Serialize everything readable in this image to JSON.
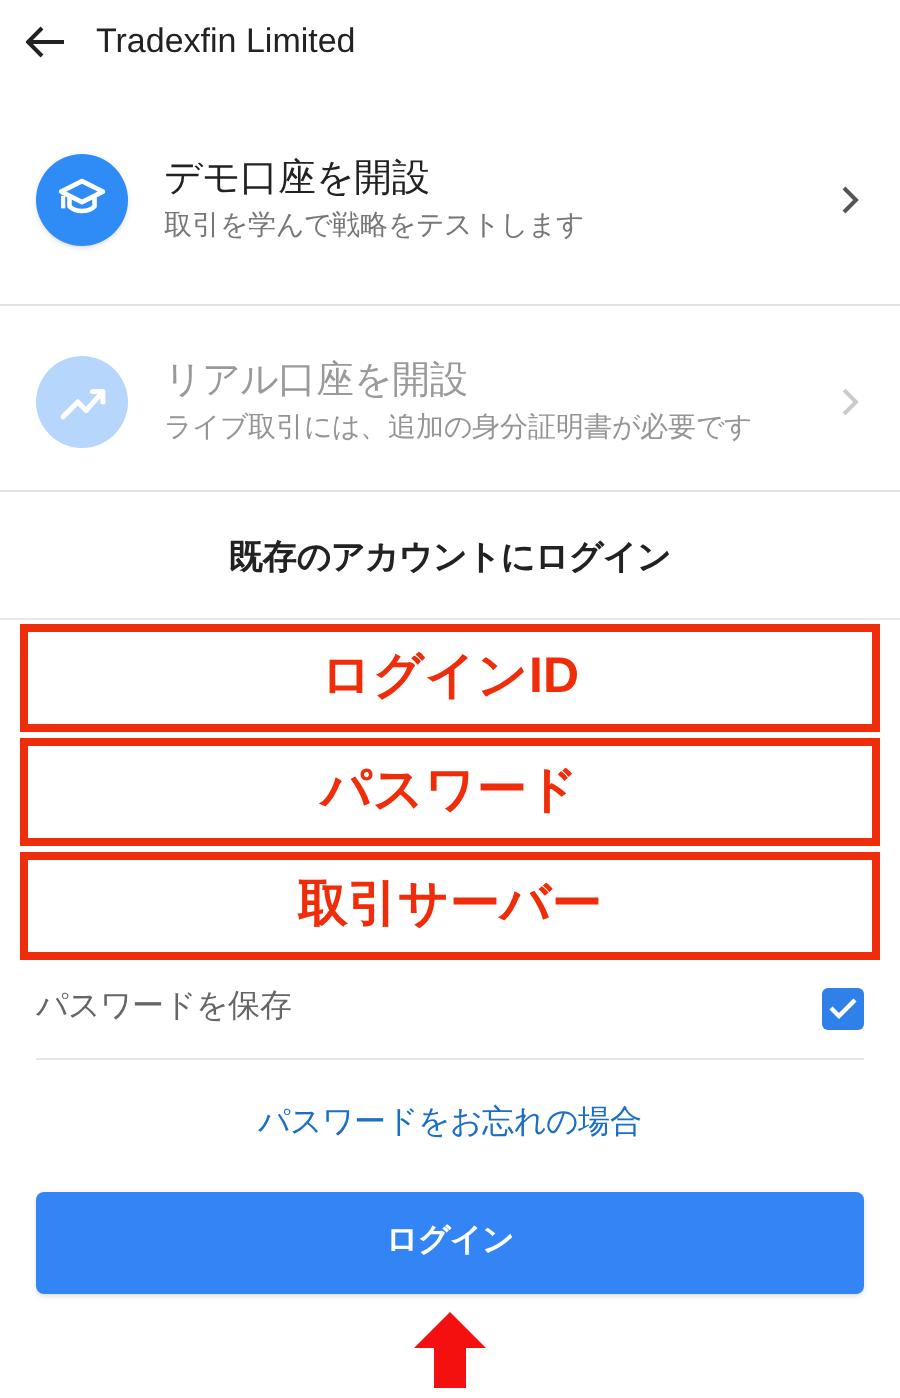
{
  "header": {
    "title": "Tradexfin Limited"
  },
  "account_options": [
    {
      "kind": "demo",
      "title": "デモ口座を開設",
      "subtitle": "取引を学んで戦略をテストします",
      "disabled": false
    },
    {
      "kind": "real",
      "title": "リアル口座を開設",
      "subtitle": "ライブ取引には、追加の身分証明書が必要です",
      "disabled": true
    }
  ],
  "login": {
    "heading": "既存のアカウントにログイン",
    "annotated_fields": [
      "ログインID",
      "パスワード",
      "取引サーバー"
    ],
    "save_password": {
      "label": "パスワードを保存",
      "checked": true
    },
    "forgot_link": "パスワードをお忘れの場合",
    "login_button": "ログイン"
  }
}
